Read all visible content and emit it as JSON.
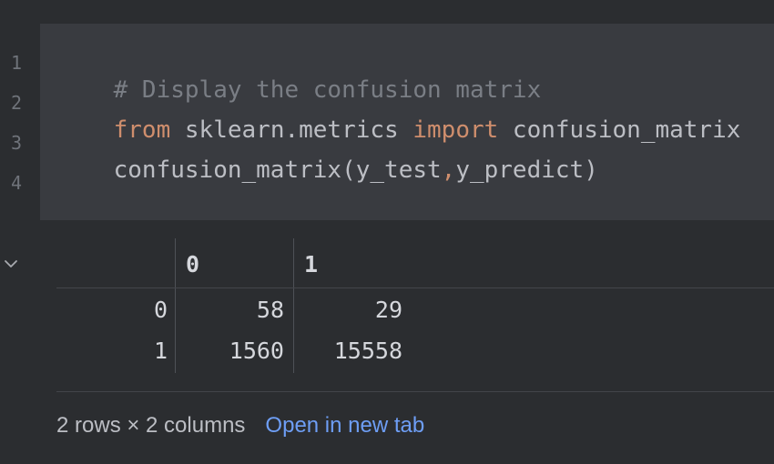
{
  "editor": {
    "line_numbers": [
      "1",
      "2",
      "3",
      "4"
    ],
    "lines": [
      [
        {
          "text": "# Display the confusion matrix",
          "kind": "comment"
        }
      ],
      [
        {
          "text": "from",
          "kind": "keyword"
        },
        {
          "text": " sklearn.metrics ",
          "kind": "plain"
        },
        {
          "text": "import",
          "kind": "keyword"
        },
        {
          "text": " confusion_matrix",
          "kind": "plain"
        }
      ],
      [
        {
          "text": "confusion_matrix(y_test",
          "kind": "plain"
        },
        {
          "text": ",",
          "kind": "keyword"
        },
        {
          "text": "y_predict)",
          "kind": "plain"
        }
      ],
      []
    ]
  },
  "output": {
    "collapse_icon": "chevron-down-icon",
    "table": {
      "columns": [
        "0",
        "1"
      ],
      "rows": [
        {
          "index": "0",
          "values": [
            "58",
            "29"
          ]
        },
        {
          "index": "1",
          "values": [
            "1560",
            "15558"
          ]
        }
      ]
    },
    "summary": "2 rows × 2 columns",
    "open_link": "Open in new tab"
  },
  "colors": {
    "background": "#2b2d30",
    "cell_background": "#393b40",
    "keyword": "#cf8e6d",
    "comment": "#7a7e85",
    "link": "#6e9ef5"
  }
}
